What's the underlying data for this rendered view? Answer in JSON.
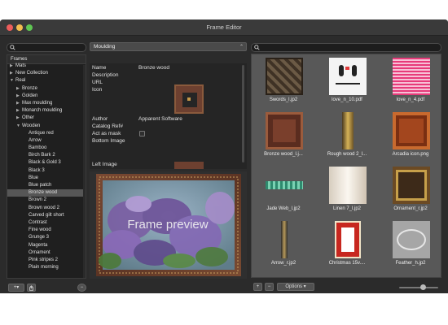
{
  "window": {
    "title": "Frame Editor"
  },
  "sidebar": {
    "header": "Frames",
    "items": [
      {
        "label": "Mats",
        "expander": "▶",
        "level": 0
      },
      {
        "label": "New Collection",
        "expander": "▶",
        "level": 0
      },
      {
        "label": "Real",
        "expander": "▼",
        "level": 0
      },
      {
        "label": "Bronze",
        "expander": "▶",
        "level": 1
      },
      {
        "label": "Golden",
        "expander": "▶",
        "level": 1
      },
      {
        "label": "Max moulding",
        "expander": "▶",
        "level": 1
      },
      {
        "label": "Monarch moulding",
        "expander": "▶",
        "level": 1
      },
      {
        "label": "Other",
        "expander": "▶",
        "level": 1
      },
      {
        "label": "Wooden",
        "expander": "▼",
        "level": 1
      },
      {
        "label": "Antique red",
        "expander": "",
        "level": 2
      },
      {
        "label": "Arrow",
        "expander": "",
        "level": 2
      },
      {
        "label": "Bamboo",
        "expander": "",
        "level": 2
      },
      {
        "label": "Birch Bark 2",
        "expander": "",
        "level": 2
      },
      {
        "label": "Black & Gold 3",
        "expander": "",
        "level": 2
      },
      {
        "label": "Black 3",
        "expander": "",
        "level": 2
      },
      {
        "label": "Blue",
        "expander": "",
        "level": 2
      },
      {
        "label": "Blue patch",
        "expander": "",
        "level": 2
      },
      {
        "label": "Bronze wood",
        "expander": "",
        "level": 2,
        "selected": true
      },
      {
        "label": "Brown 2",
        "expander": "",
        "level": 2
      },
      {
        "label": "Brown wood 2",
        "expander": "",
        "level": 2
      },
      {
        "label": "Carved gilt short",
        "expander": "",
        "level": 2
      },
      {
        "label": "Contrast",
        "expander": "",
        "level": 2
      },
      {
        "label": "Fine wood",
        "expander": "",
        "level": 2
      },
      {
        "label": "Grunge 3",
        "expander": "",
        "level": 2
      },
      {
        "label": "Magenta",
        "expander": "",
        "level": 2
      },
      {
        "label": "Ornament",
        "expander": "",
        "level": 2
      },
      {
        "label": "Pink stripes 2",
        "expander": "",
        "level": 2
      },
      {
        "label": "Plain morning",
        "expander": "",
        "level": 2
      }
    ],
    "add_label": "+",
    "add_menu_caret": "▾",
    "remove_label": "−"
  },
  "middle": {
    "type_select": "Moulding",
    "type_caret": "⌃",
    "properties": {
      "name_label": "Name",
      "name_value": "Bronze wood",
      "description_label": "Description",
      "url_label": "URL",
      "icon_label": "Icon",
      "author_label": "Author",
      "author_value": "Apparent Software",
      "catalog_label": "Catalog Ref#",
      "act_mask_label": "Act as mask",
      "bottom_image_label": "Bottom Image",
      "left_image_label": "Left Image"
    },
    "preview_text": "Frame preview",
    "remove_label": "−"
  },
  "grid": {
    "items": [
      {
        "caption": "Swords_l.jp2"
      },
      {
        "caption": "love_n_10.pdf"
      },
      {
        "caption": "love_n_4.pdf"
      },
      {
        "caption": "Bronze wood_l.j..."
      },
      {
        "caption": "Rough wood 2_l..."
      },
      {
        "caption": "Arcadia icon.png"
      },
      {
        "caption": "Jade Web_l.jp2"
      },
      {
        "caption": "Linen 7_l.jp2"
      },
      {
        "caption": "Ornament_r.jp2"
      },
      {
        "caption": "Arrow_r.jp2"
      },
      {
        "caption": "Christmas 15v...."
      },
      {
        "caption": "Feather_h.jp2"
      }
    ],
    "add_label": "+",
    "remove_label": "−",
    "options_label": "Options",
    "options_caret": "▾"
  }
}
